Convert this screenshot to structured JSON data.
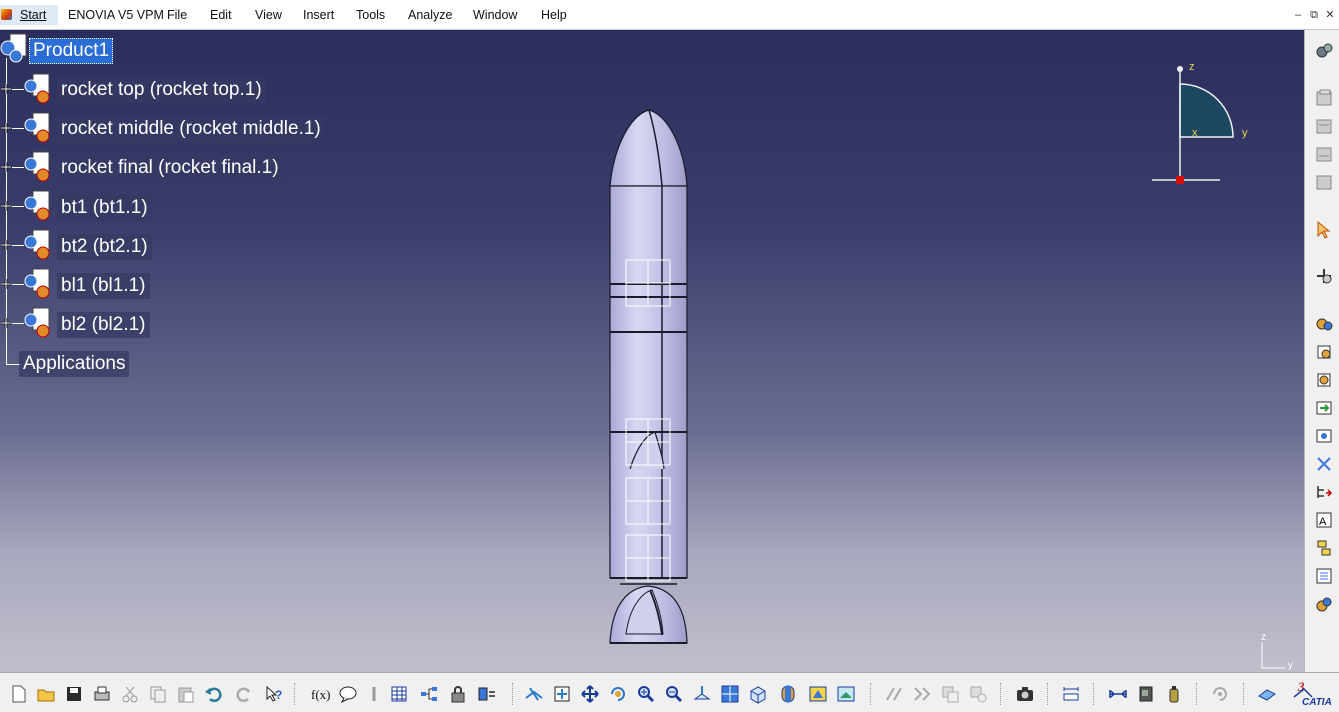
{
  "menubar": {
    "start": "Start",
    "items": [
      "ENOVIA V5 VPM",
      "File",
      "Edit",
      "View",
      "Insert",
      "Tools",
      "Analyze",
      "Window",
      "Help"
    ]
  },
  "window_controls": {
    "minimize": "–",
    "restore": "⧉",
    "close": "✕"
  },
  "tree": {
    "root": "Product1",
    "children": [
      "rocket top (rocket top.1)",
      "rocket middle (rocket middle.1)",
      "rocket final (rocket final.1)",
      "bt1 (bt1.1)",
      "bt2 (bt2.1)",
      "bl1 (bl1.1)",
      "bl2 (bl2.1)"
    ],
    "applications": "Applications"
  },
  "compass": {
    "z": "z",
    "x": "x",
    "y": "y"
  },
  "axis_small": {
    "z": "z",
    "y": "y"
  },
  "colors": {
    "viewport_top": "#2b2e5d",
    "viewport_bottom": "#bfbfcc",
    "selection": "#2a6dd6",
    "rocket_fill": "#c4c4e6",
    "compass_fill": "#1d4660"
  },
  "right_toolbar_icons": [
    "gear-assembly-icon",
    "catalog-icon",
    "existing-component-icon",
    "existing-component-positioning-icon",
    "replace-component-icon",
    "select-arrow-icon",
    "manipulate-icon",
    "product-icon",
    "part-icon",
    "component-icon",
    "fix-together-icon",
    "snap-icon",
    "explode-icon",
    "graph-tree-icon",
    "bill-of-material-icon",
    "reorder-icon",
    "multi-instantiation-icon",
    "fast-multi-instantiation-icon"
  ],
  "bottom_toolbar_icons": [
    "new-icon",
    "open-icon",
    "save-icon",
    "print-icon",
    "cut-icon",
    "copy-icon",
    "paste-icon",
    "undo-icon",
    "redo-icon",
    "whats-this-icon",
    "formula-icon",
    "knowledge-icon",
    "tools-icon",
    "table-icon",
    "tree-icon",
    "lock-icon",
    "parameters-icon",
    "fly-mode-icon",
    "fit-all-icon",
    "pan-icon",
    "rotate-icon",
    "zoom-in-icon",
    "zoom-out-icon",
    "normal-view-icon",
    "multi-view-icon",
    "iso-view-icon",
    "hide-show-icon",
    "swap-visible-icon",
    "shading-icon",
    "clash-icon",
    "distance-icon",
    "section-icon",
    "capture-icon",
    "measure-icon",
    "catalog-browser-icon",
    "thread-icon",
    "spin-icon",
    "catia-logo-icon"
  ]
}
